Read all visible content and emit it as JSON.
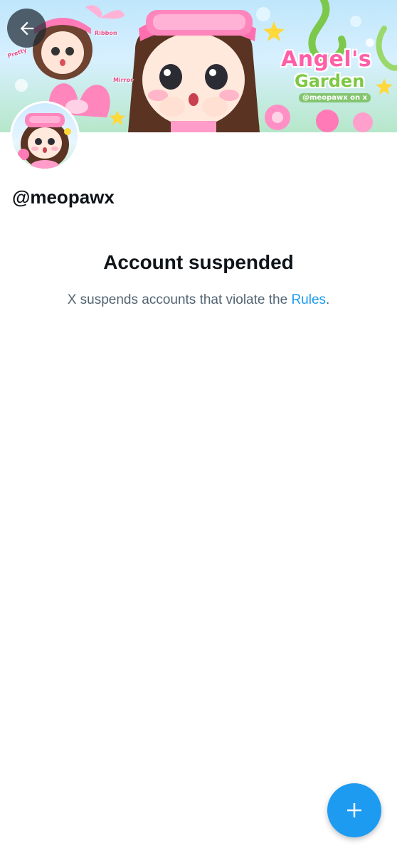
{
  "banner": {
    "title_line1": "Angel's",
    "title_line2": "Garden",
    "handle_tag": "@meopawx on x",
    "label_pretty": "Pretty",
    "label_ribbon": "Ribbon",
    "label_mirror": "Mirror"
  },
  "profile": {
    "handle": "@meopawx"
  },
  "suspension": {
    "title": "Account suspended",
    "description": "X suspends accounts that violate the ",
    "rules_link": "Rules",
    "period": "."
  },
  "icons": {
    "back": "arrow-left-icon",
    "compose": "plus-icon"
  },
  "colors": {
    "accent": "#1d9bf0",
    "text_primary": "#0f1419",
    "text_secondary": "#536471"
  }
}
